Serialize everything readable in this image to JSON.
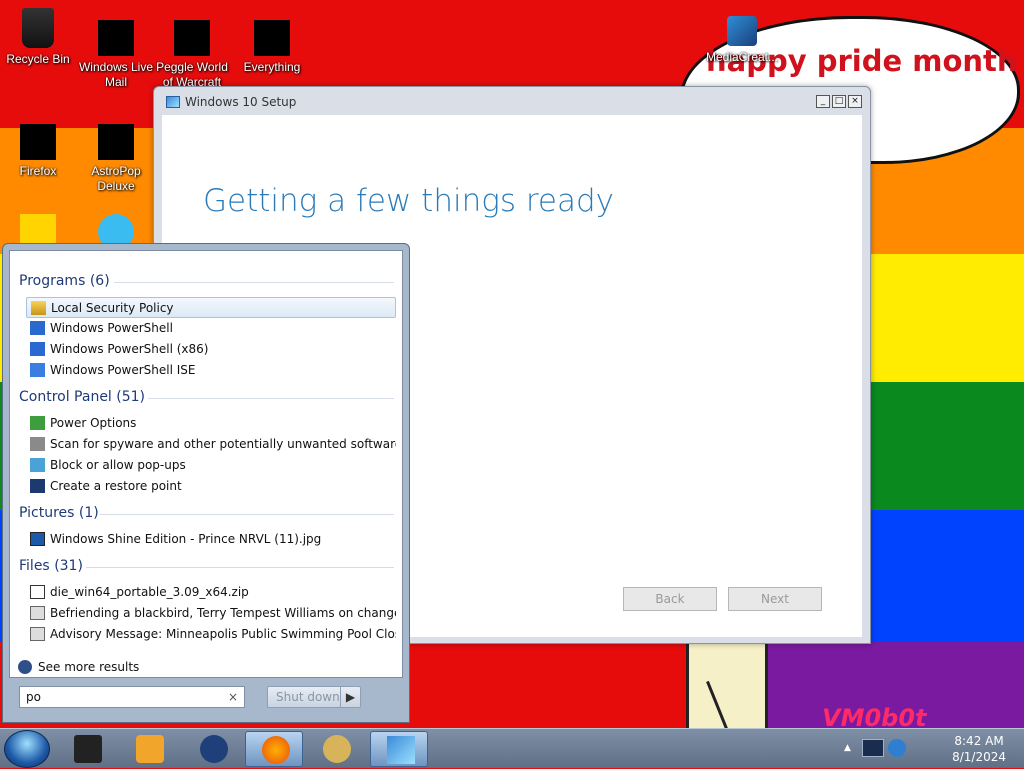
{
  "desktop": {
    "icons": [
      {
        "label": "Recycle Bin"
      },
      {
        "label": "Windows Live Mail"
      },
      {
        "label": "Peggle World of Warcraft"
      },
      {
        "label": "Everything"
      },
      {
        "label": "Firefox"
      },
      {
        "label": "AstroPop Deluxe"
      },
      {
        "label": "MediaCreat..."
      }
    ],
    "wallpaper_text": "happy pride month",
    "watermark": "VM0b0t",
    "colors": {
      "red": "#e70c0c",
      "orange": "#ff8a00",
      "yellow": "#ffec00",
      "green": "#0a8a1e",
      "blue": "#0043ff",
      "purple": "#7a1aa0"
    }
  },
  "setup_window": {
    "title": "Windows 10 Setup",
    "heading": "Getting a few things ready",
    "back_label": "Back",
    "next_label": "Next"
  },
  "start_menu": {
    "groups": [
      {
        "title": "Programs",
        "count": "(6)",
        "items": [
          "Local Security Policy",
          "Windows PowerShell",
          "Windows PowerShell (x86)",
          "Windows PowerShell ISE"
        ]
      },
      {
        "title": "Control Panel",
        "count": "(51)",
        "items": [
          "Power Options",
          "Scan for spyware and other potentially unwanted software",
          "Block or allow pop-ups",
          "Create a restore point"
        ]
      },
      {
        "title": "Pictures",
        "count": "(1)",
        "items": [
          "Windows Shine Edition - Prince NRVL (11).jpg"
        ]
      },
      {
        "title": "Files",
        "count": "(31)",
        "items": [
          "die_win64_portable_3.09_x64.zip",
          "Befriending a blackbird, Terry Tempest Williams on change and...",
          "Advisory Message: Minneapolis Public Swimming Pool Closed"
        ]
      }
    ],
    "see_more": "See more results",
    "search_value": "po",
    "clear_glyph": "×",
    "shutdown_label": "Shut down",
    "shutdown_arrow": "▶"
  },
  "taskbar": {
    "time": "8:42 AM",
    "date": "8/1/2024"
  }
}
